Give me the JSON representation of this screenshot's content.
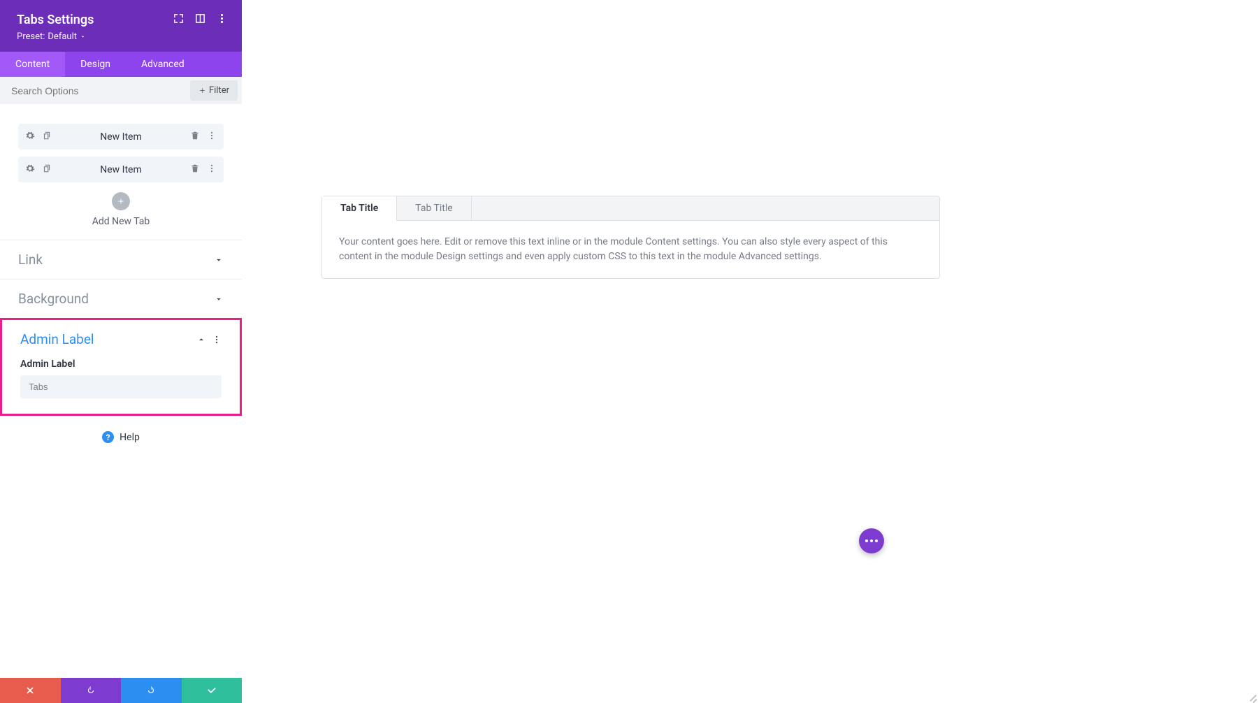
{
  "header": {
    "title": "Tabs Settings",
    "preset_label": "Preset:",
    "preset_value": "Default"
  },
  "tabs": {
    "content": "Content",
    "design": "Design",
    "advanced": "Advanced"
  },
  "search": {
    "placeholder": "Search Options",
    "filter_label": "Filter"
  },
  "items": [
    {
      "label": "New Item"
    },
    {
      "label": "New Item"
    }
  ],
  "add_tab_label": "Add New Tab",
  "accordions": {
    "link": "Link",
    "background": "Background",
    "admin_label": {
      "title": "Admin Label",
      "field_label": "Admin Label",
      "field_value": "Tabs"
    }
  },
  "help_label": "Help",
  "preview": {
    "tabs": [
      "Tab Title",
      "Tab Title"
    ],
    "content": "Your content goes here. Edit or remove this text inline or in the module Content settings. You can also style every aspect of this content in the module Design settings and even apply custom CSS to this text in the module Advanced settings."
  }
}
